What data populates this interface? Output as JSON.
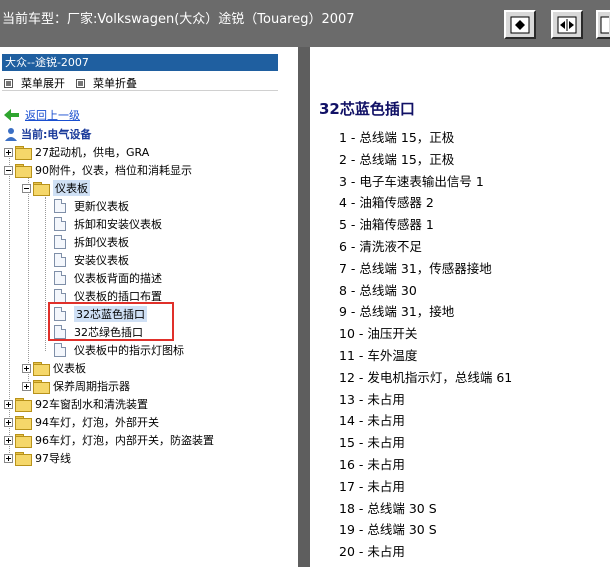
{
  "window": {
    "title": "当前车型：厂家:Volkswagen(大众）途锐（Touareg）2007"
  },
  "toolbar": {
    "buttons": [
      {
        "icon": "diamond-right-icon"
      },
      {
        "icon": "split-arrows-icon"
      },
      {
        "icon": "partial-button-icon"
      }
    ]
  },
  "sidebar": {
    "selected_header": "大众--途锐-2007",
    "expand_label": "菜单展开",
    "collapse_label": "菜单折叠",
    "back_label": "返回上一级",
    "current_label": "当前:电气设备",
    "tree": [
      "27起动机，供电，GRA",
      "90附件，仪表，档位和消耗显示",
      "仪表板",
      "更新仪表板",
      "拆卸和安装仪表板",
      "拆卸仪表板",
      "安装仪表板",
      "仪表板背面的描述",
      "仪表板的插口布置",
      "32芯蓝色插口",
      "32芯绿色插口",
      "仪表板中的指示灯图标",
      "仪表板",
      "保养周期指示器",
      "92车窗刮水和清洗装置",
      "94车灯，灯泡，外部开关",
      "96车灯，灯泡，内部开关，防盗装置",
      "97导线"
    ]
  },
  "content": {
    "heading": "32芯蓝色插口",
    "pins": [
      "1 - 总线端  15，正极",
      "2 - 总线端  15，正极",
      "3 - 电子车速表输出信号  1",
      "4 - 油箱传感器  2",
      "5 - 油箱传感器  1",
      "6 - 清洗液不足",
      "7 - 总线端  31，传感器接地",
      "8 - 总线端  30",
      "9 - 总线端  31，接地",
      "10 - 油压开关",
      "11 - 车外温度",
      "12 - 发电机指示灯，总线端  61",
      "13 - 未占用",
      "14 - 未占用",
      "15 - 未占用",
      "16 - 未占用",
      "17 - 未占用",
      "18 - 总线端  30 S",
      "19 - 总线端  30 S",
      "20 - 未占用",
      "21 - 未占用"
    ]
  }
}
